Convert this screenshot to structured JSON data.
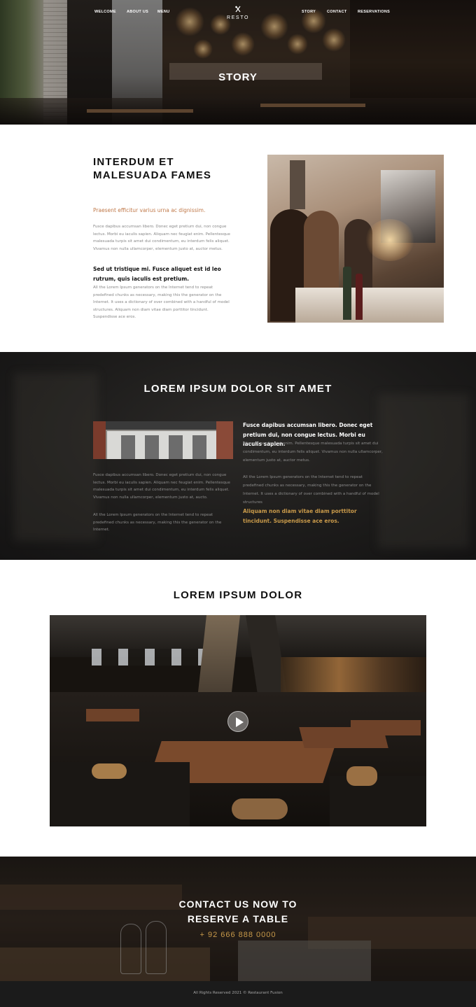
{
  "nav": {
    "left": [
      "WELCOME",
      "ABOUT US",
      "MENU"
    ],
    "right": [
      "STORY",
      "CONTACT",
      "RESERVATIONS"
    ],
    "logo_text": "RESTO",
    "logo_icon": "fork-knife-icon"
  },
  "hero": {
    "title": "STORY"
  },
  "section1": {
    "heading": "INTERDUM ET MALESUADA FAMES",
    "subtitle": "Praesent efficitur varius urna ac dignissim.",
    "paragraph1": "Fusce dapibus accumsan libero. Donec eget pretium dui, non congue lectus. Morbi eu iaculis sapien. Aliquam nec feugiat enim. Pellentesque malesuada turpis sit amet dui condimentum, eu interdum felis aliquet. Vivamus non nulla ullamcorper, elementum justo at, auctor metus.",
    "bold_text": "Sed ut tristique mi. Fusce aliquet est id leo rutrum, quis iaculis est pretium.",
    "paragraph2": "All the Lorem Ipsum generators on the Internet tend to repeat predefined chunks as necessary, making this the generator on the Internet. It uses a dictionary of over combined with a handful of model structures. Aliquam non diam vitae diam porttitor tincidunt. Suspendisse ace eros."
  },
  "section2": {
    "heading": "LOREM IPSUM DOLOR SIT AMET",
    "left_paragraph1": "Fusce dapibus accumsan libero. Donec eget pretium dui, non congue lectus. Morbi eu iaculis sapien. Aliquam nec feugiat enim. Pellentesque malesuada turpis sit amet dui condimentum, eu interdum felis aliquet. Vivamus non nulla ullamcorper, elementum justo at, aucto.",
    "left_paragraph2": "All the Lorem Ipsum generators on the Internet tend to repeat predefined chunks as necessary, making this the generator on the Internet.",
    "right_bold": "Fusce dapibus accumsan libero. Donec eget pretium dui, non congue lectus. Morbi eu iaculis sapien.",
    "right_paragraph1": "Aliquam nec feugiat enim. Pellentesque malesuada turpis sit amet dui condimentum, eu interdum felis aliquet. Vivamus non nulla ullamcorper, elementum justo at, auctor metus.",
    "right_paragraph2": "All the Lorem Ipsum generators on the Internet tend to repeat predefined chunks as necessary, making this the generator on the Internet. It uses a dictionary of over combined with a handful of model structures",
    "right_gold": "Aliquam non diam vitae diam porttitor tincidunt. Suspendisse ace eros."
  },
  "section3": {
    "heading": "LOREM IPSUM DOLOR",
    "play_icon": "play-icon"
  },
  "section4": {
    "heading": "CONTACT US NOW TO RESERVE A TABLE",
    "phone": "+ 92 666 888 0000"
  },
  "footer": {
    "copyright": "All Rights Reserved 2021 © Restaurant Fusion"
  },
  "colors": {
    "accent_orange": "#c0794a",
    "accent_gold": "#c99a4a",
    "dark_bg": "#1c1b1a",
    "footer_bg": "#1b1b1b"
  }
}
